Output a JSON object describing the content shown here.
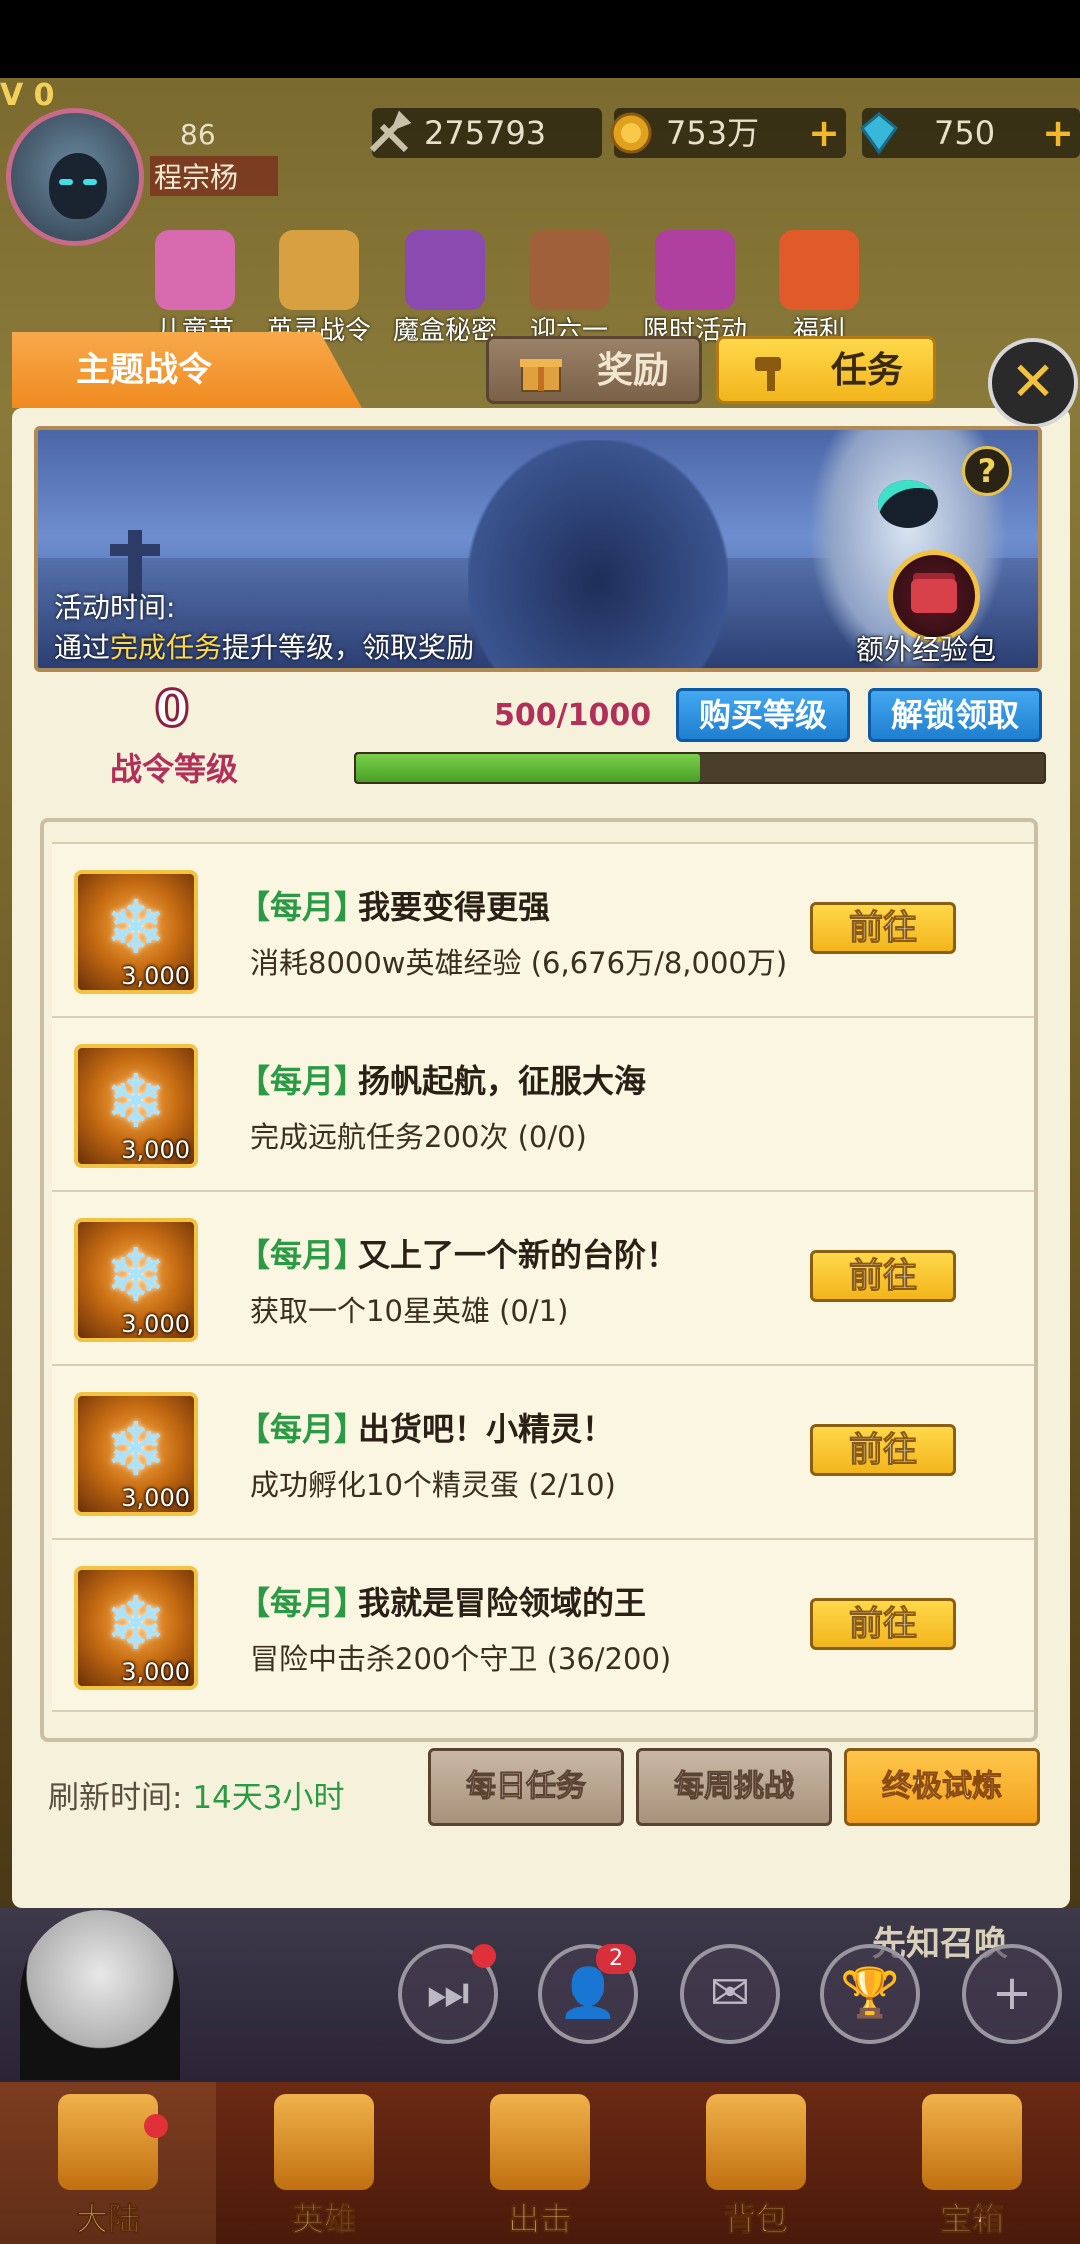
{
  "player": {
    "vip": "V 0",
    "level": "86",
    "name": "程宗杨"
  },
  "resources": [
    {
      "icon": "sword-icon",
      "value": "275793",
      "plus": ""
    },
    {
      "icon": "gold-coin-icon",
      "value": "753万",
      "plus": "+"
    },
    {
      "icon": "diamond-icon",
      "value": "750",
      "plus": "+"
    }
  ],
  "events": [
    "儿童节",
    "英灵战令",
    "魔盒秘密",
    "迎六一",
    "限时活动",
    "福利"
  ],
  "panel": {
    "title": "主题战令",
    "tabs": {
      "reward": "奖励",
      "task": "任务"
    },
    "close": "✕",
    "banner": {
      "help": "?",
      "time_label": "活动时间:",
      "desc_pre": "通过",
      "desc_hl": "完成任务",
      "desc_post": "提升等级，领取奖励",
      "exp_label": "额外经验包"
    },
    "level": {
      "value": "0",
      "label": "战令等级",
      "progress_text": "500/1000",
      "progress": 0.5
    },
    "buttons": {
      "buy": "购买等级",
      "unlock": "解锁领取"
    }
  },
  "tasks": [
    {
      "reward": "3,000",
      "tag": "【每月】",
      "title": "我要变得更强",
      "desc": "消耗8000w英雄经验 (6,676万/8,000万)",
      "action": "前往"
    },
    {
      "reward": "3,000",
      "tag": "【每月】",
      "title": "扬帆起航，征服大海",
      "desc": "完成远航任务200次 (0/0)",
      "action": ""
    },
    {
      "reward": "3,000",
      "tag": "【每月】",
      "title": "又上了一个新的台阶！",
      "desc": "获取一个10星英雄 (0/1)",
      "action": "前往"
    },
    {
      "reward": "3,000",
      "tag": "【每月】",
      "title": "出货吧！小精灵！",
      "desc": "成功孵化10个精灵蛋 (2/10)",
      "action": "前往"
    },
    {
      "reward": "3,000",
      "tag": "【每月】",
      "title": "我就是冒险领域的王",
      "desc": "冒险中击杀200个守卫 (36/200)",
      "action": "前往"
    }
  ],
  "footer": {
    "refresh_label": "刷新时间: ",
    "refresh_time": "14天3小时",
    "tabs": [
      "每日任务",
      "每周挑战",
      "终极试炼"
    ]
  },
  "scene": {
    "summon": "先知召唤",
    "friends_badge": "2"
  },
  "nav": [
    "大陆",
    "英雄",
    "出击",
    "背包",
    "宝箱"
  ]
}
